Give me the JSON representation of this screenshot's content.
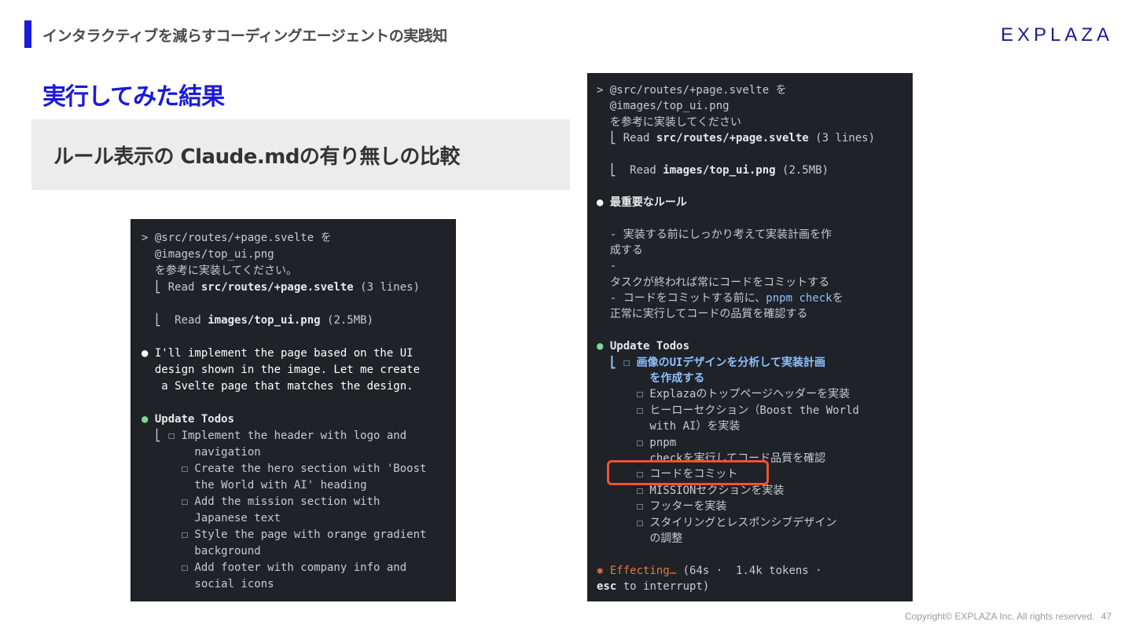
{
  "header": {
    "title": "インタラクティブを減らすコーディングエージェントの実践知",
    "logo": "EXPLAZA"
  },
  "slide": {
    "title": "実行してみた結果",
    "subtitle": "ルール表示の Claude.mdの有り無しの比較"
  },
  "left_terminal": {
    "prompt1": "> @src/routes/+page.svelte を",
    "prompt2": "  @images/top_ui.png",
    "prompt3": "  を参考に実装してください。",
    "read1_prefix": "  ⎣ Read ",
    "read1_file": "src/routes/+page.svelte",
    "read1_suffix": " (3 lines)",
    "read2_prefix": "  ⎣  Read ",
    "read2_file": "images/top_ui.png",
    "read2_suffix": " (2.5MB)",
    "msg1": "● I'll implement the page based on the UI",
    "msg2": "  design shown in the image. Let me create",
    "msg3": "   a Svelte page that matches the design.",
    "todos_bullet": "● ",
    "todos_title": "Update Todos",
    "todos": [
      "  ⎣ ☐ Implement the header with logo and",
      "        navigation",
      "      ☐ Create the hero section with 'Boost",
      "        the World with AI' heading",
      "      ☐ Add the mission section with",
      "        Japanese text",
      "      ☐ Style the page with orange gradient",
      "        background",
      "      ☐ Add footer with company info and",
      "        social icons"
    ]
  },
  "right_terminal": {
    "prompt1": "> @src/routes/+page.svelte を",
    "prompt2": "  @images/top_ui.png",
    "prompt3": "  を参考に実装してください",
    "read1_prefix": "  ⎣ Read ",
    "read1_file": "src/routes/+page.svelte",
    "read1_suffix": " (3 lines)",
    "read2_prefix": "  ⎣  Read ",
    "read2_file": "images/top_ui.png",
    "read2_suffix": " (2.5MB)",
    "rules_bullet": "● ",
    "rules_title": "最重要なルール",
    "rules": [
      "  - 実装する前にしっかり考えて実装計画を作",
      "  成する",
      "  -",
      "  タスクが終われば常にコードをコミットする"
    ],
    "rule_check_pre": "  - コードをコミットする前に、",
    "rule_check_cmd": "pnpm check",
    "rule_check_post": "を",
    "rule_last": "  正常に実行してコードの品質を確認する",
    "todos_bullet": "● ",
    "todos_title": "Update Todos",
    "todo_active_1": "  ⎣ ☐ 画像のUIデザインを分析して実装計画",
    "todo_active_2": "        を作成する",
    "todos": [
      "      ☐ Explazaのトップページヘッダーを実装",
      "      ☐ ヒーローセクション（Boost the World",
      "        with AI）を実装",
      "      ☐ pnpm",
      "        checkを実行してコード品質を確認",
      "      ☐ コードをコミット",
      "      ☐ MISSIONセクションを実装",
      "      ☐ フッターを実装",
      "      ☐ スタイリングとレスポンシブデザイン",
      "        の調整"
    ],
    "status_effecting": "✱ Effecting…",
    "status_rest": " (64s ·  1.4k tokens ·",
    "status_esc": "esc",
    "status_interrupt": " to interrupt)"
  },
  "footer": {
    "copyright": "Copyright© EXPLAZA Inc. All rights reserved.",
    "page": "47"
  }
}
